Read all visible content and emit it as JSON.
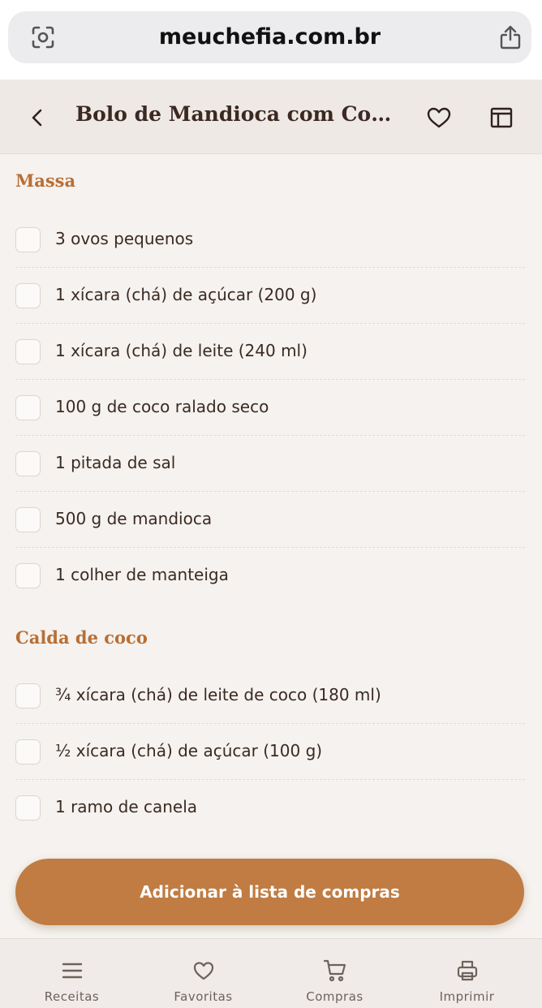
{
  "browser": {
    "url": "meuchefia.com.br",
    "left_icon": "page-scan-icon",
    "right_icon": "share-icon"
  },
  "header": {
    "title": "Bolo de Mandioca com Cobert...",
    "back_icon": "chevron-left-icon",
    "favorite_icon": "heart-icon",
    "table_icon": "table-layout-icon"
  },
  "sections": [
    {
      "title": "Massa",
      "items": [
        "3 ovos pequenos",
        "1 xícara (chá) de açúcar (200 g)",
        "1 xícara (chá) de leite (240 ml)",
        "100 g de coco ralado seco",
        "1 pitada de sal",
        "500 g de mandioca",
        "1 colher de manteiga"
      ]
    },
    {
      "title": "Calda de coco",
      "items": [
        "¾ xícara (chá) de leite de coco (180 ml)",
        "½ xícara (chá) de açúcar (100 g)",
        "1 ramo de canela"
      ]
    }
  ],
  "cta": {
    "label": "Adicionar à lista de compras"
  },
  "tabs": [
    {
      "label": "Receitas",
      "icon": "menu-icon"
    },
    {
      "label": "Favoritas",
      "icon": "heart-icon"
    },
    {
      "label": "Compras",
      "icon": "cart-icon"
    },
    {
      "label": "Imprimir",
      "icon": "printer-icon"
    }
  ],
  "colors": {
    "accent": "#c07c42",
    "section_title": "#b86f35",
    "background": "#f5f2ef",
    "header_bg": "#efe9e6"
  }
}
